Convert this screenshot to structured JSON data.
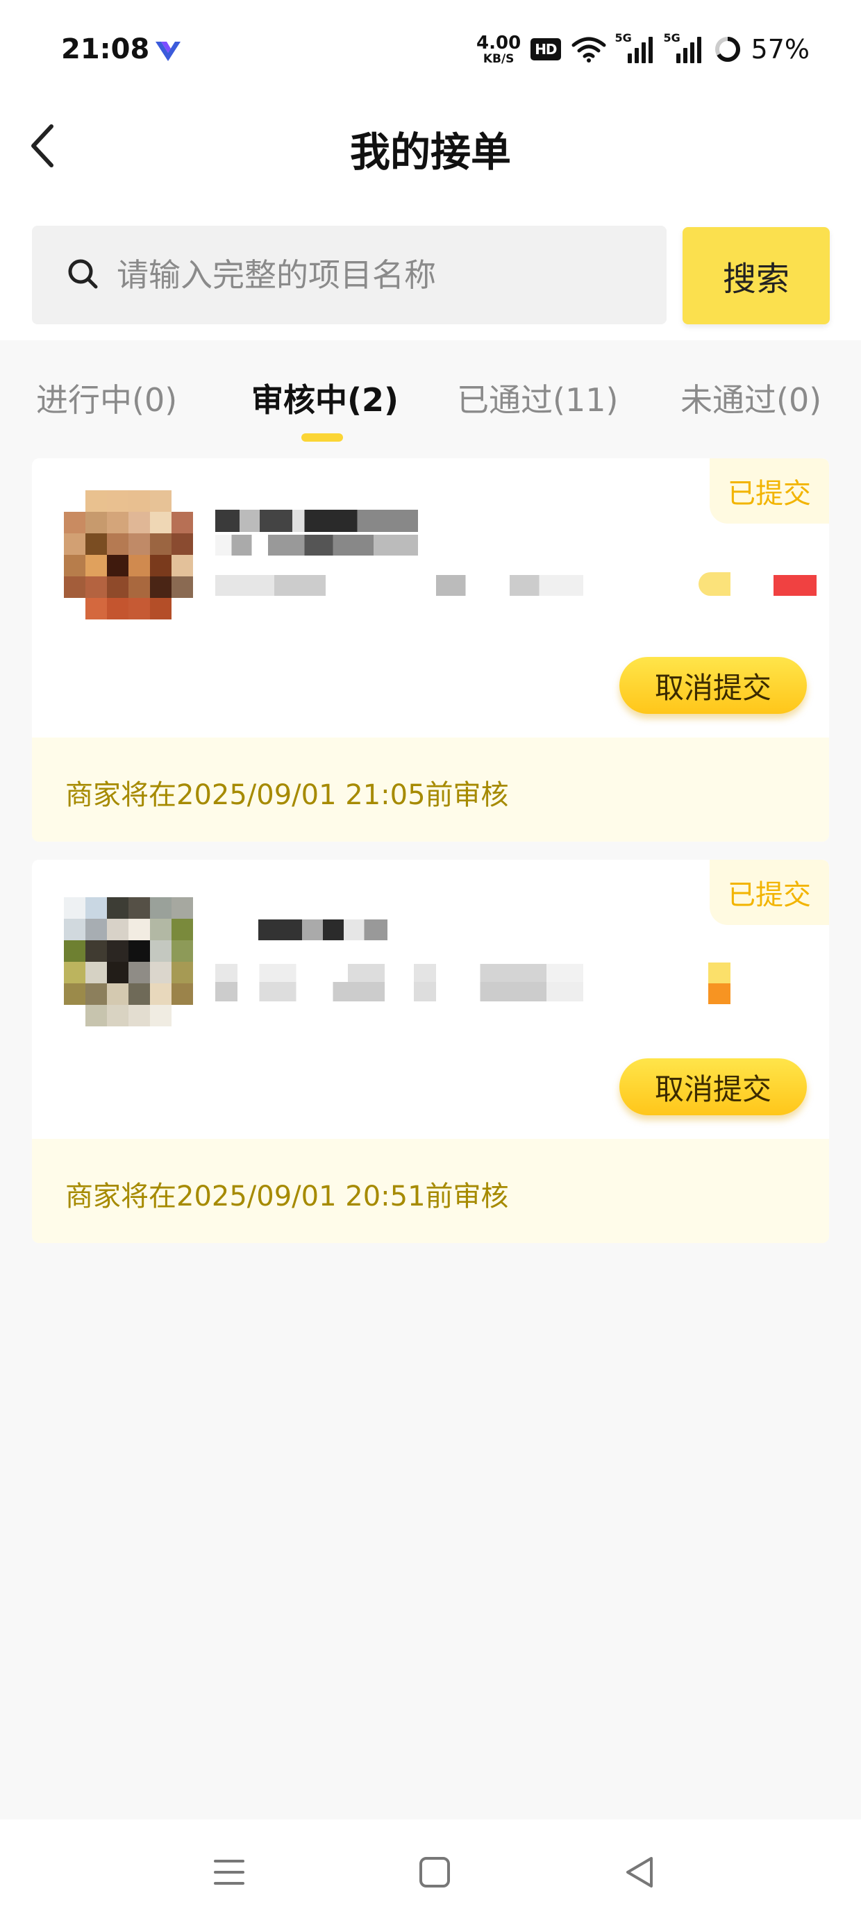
{
  "status_bar": {
    "time": "21:08",
    "net_speed_value": "4.00",
    "net_speed_unit": "KB/S",
    "hd_label": "HD",
    "signal_1_tag": "5G",
    "signal_2_tag": "5G",
    "battery": "57%"
  },
  "header": {
    "title": "我的接单"
  },
  "search": {
    "placeholder": "请输入完整的项目名称",
    "button_label": "搜索"
  },
  "tabs": [
    {
      "label": "进行中(0)",
      "active": false
    },
    {
      "label": "审核中(2)",
      "active": true
    },
    {
      "label": "已通过(11)",
      "active": false
    },
    {
      "label": "未通过(0)",
      "active": false
    }
  ],
  "orders": [
    {
      "status": "已提交",
      "action_label": "取消提交",
      "deadline_text": "商家将在2025/09/01 21:05前审核"
    },
    {
      "status": "已提交",
      "action_label": "取消提交",
      "deadline_text": "商家将在2025/09/01 20:51前审核"
    }
  ],
  "colors": {
    "accent_yellow": "#fbe04e",
    "status_text": "#f2b400",
    "deadline_text": "#a68a00",
    "footer_bg": "#fffcea"
  }
}
